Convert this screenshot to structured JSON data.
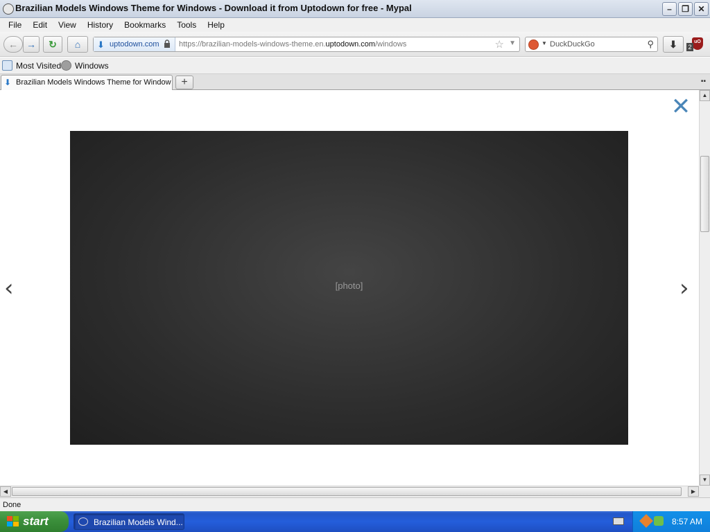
{
  "window": {
    "title": "Brazilian Models Windows Theme for Windows - Download it from Uptodown for free - Mypal",
    "minimize": "–",
    "restore": "❐",
    "close": "✕"
  },
  "menubar": {
    "items": [
      "File",
      "Edit",
      "View",
      "History",
      "Bookmarks",
      "Tools",
      "Help"
    ]
  },
  "navbar": {
    "back_icon": "←",
    "forward_icon": "→",
    "reload_icon": "↻",
    "home_icon": "⌂",
    "site_identity": "uptodown.com",
    "url_prefix": "https://brazilian-models-windows-theme.en.",
    "url_domain": "uptodown.com",
    "url_suffix": "/windows",
    "search_engine": "DuckDuckGo",
    "download_icon": "⬇",
    "ublock_count": "2"
  },
  "bookmarks": {
    "items": [
      "Most Visited",
      "Windows"
    ]
  },
  "tabs": [
    {
      "title": "Brazilian Models Windows Theme for Window..."
    }
  ],
  "content": {
    "close_glyph": "✕",
    "prev_glyph": "‹",
    "next_glyph": "›",
    "photo_label": "[photo]"
  },
  "statusbar": {
    "text": "Done"
  },
  "taskbar": {
    "start_label": "start",
    "task_label": "Brazilian Models Wind...",
    "clock": "8:57 AM"
  },
  "colors": {
    "taskbar_blue": "#245edb",
    "start_green": "#3b8f3b",
    "close_x_blue": "#4a86b8",
    "photo_background": "#2c2c2c"
  },
  "icons": {
    "app": "mypal-icon",
    "lock": "lock-icon",
    "star": "bookmark-star-icon",
    "search": "search-icon",
    "download": "download-icon",
    "ublock": "ublock-icon"
  }
}
